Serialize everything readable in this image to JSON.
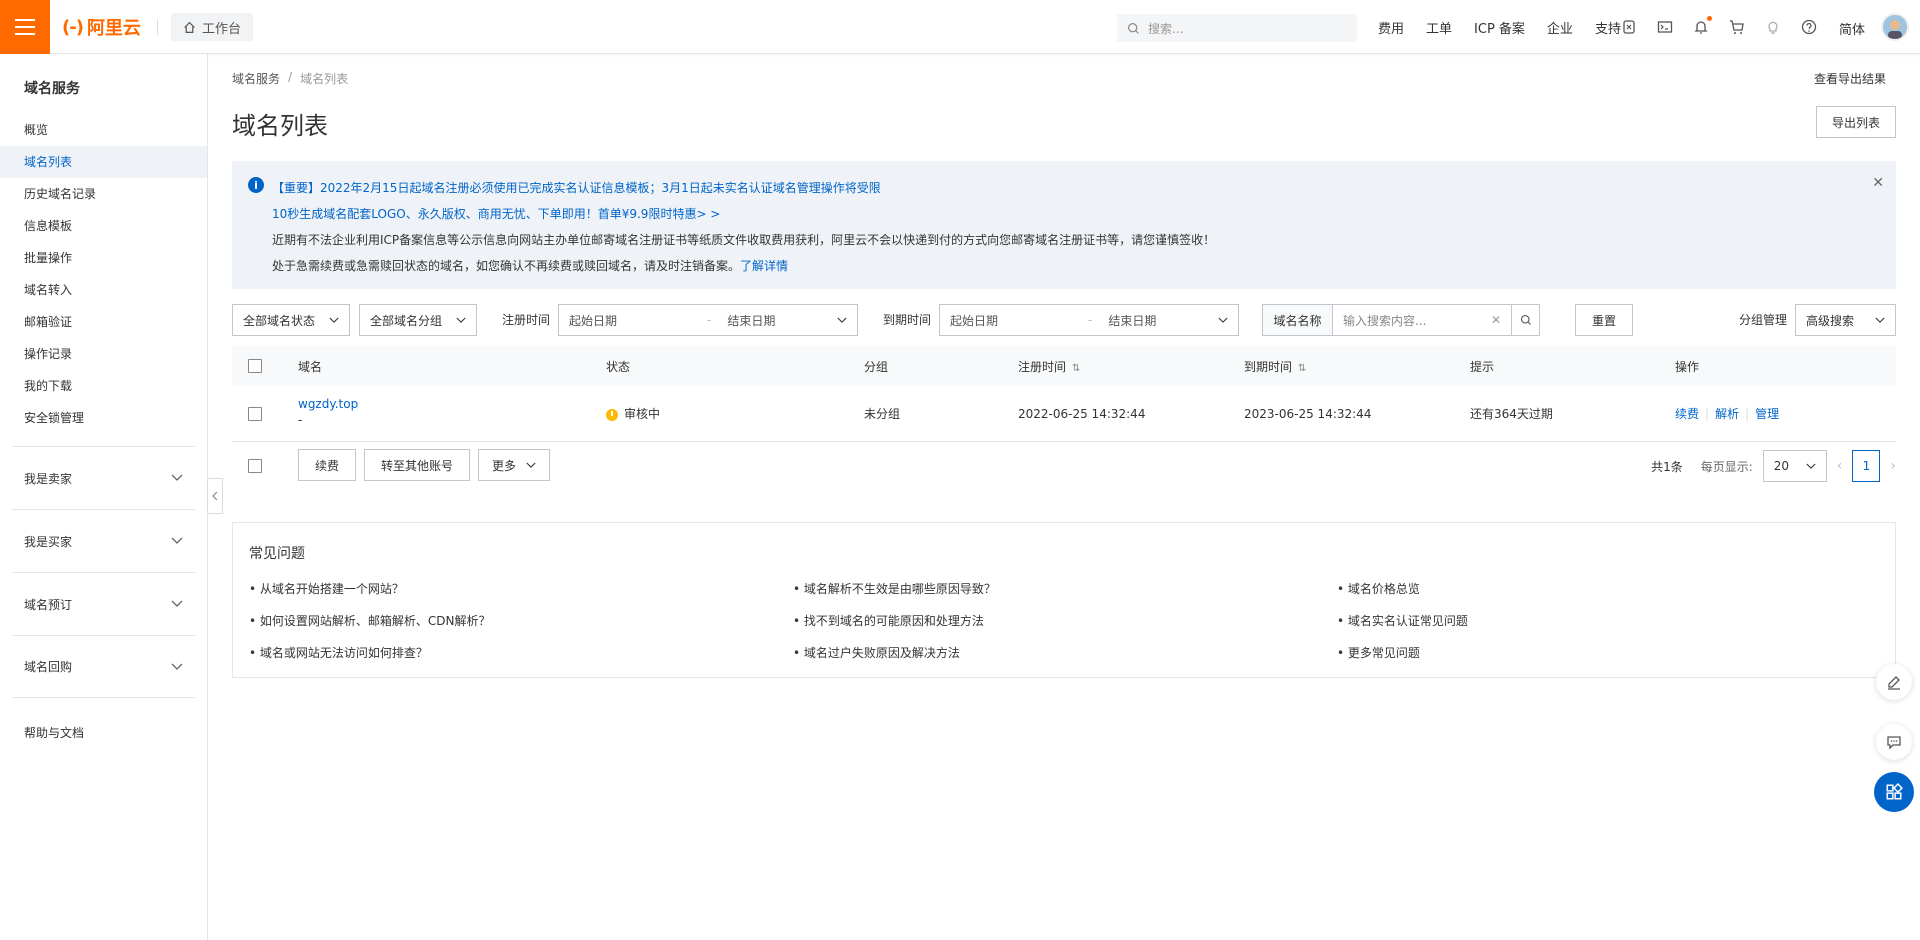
{
  "topbar": {
    "logo_text": "阿里云",
    "workbench": "工作台",
    "search_placeholder": "搜索...",
    "links": [
      "费用",
      "工单",
      "ICP 备案",
      "企业",
      "支持"
    ],
    "lang": "简体",
    "accent": "#ff6a00"
  },
  "sidebar": {
    "title": "域名服务",
    "items": [
      "概览",
      "域名列表",
      "历史域名记录",
      "信息模板",
      "批量操作",
      "域名转入",
      "邮箱验证",
      "操作记录",
      "我的下载",
      "安全锁管理"
    ],
    "active_index": 1,
    "groups": [
      "我是卖家",
      "我是买家",
      "域名预订",
      "域名回购"
    ],
    "help": "帮助与文档"
  },
  "breadcrumb": {
    "root": "域名服务",
    "sep": "/",
    "current": "域名列表"
  },
  "export_result": "查看导出结果",
  "page_title": "域名列表",
  "export_button": "导出列表",
  "notice": {
    "line1": "【重要】2022年2月15日起域名注册必须使用已完成实名认证信息模板；3月1日起未实名认证域名管理操作将受限",
    "line2": "10秒生成域名配套LOGO、永久版权、商用无忧、下单即用！首单¥9.9限时特惠> >",
    "line3": "近期有不法企业利用ICP备案信息等公示信息向网站主办单位邮寄域名注册证书等纸质文件收取费用获利，阿里云不会以快递到付的方式向您邮寄域名注册证书等，请您谨慎签收！",
    "line4": "处于急需续费或急需赎回状态的域名，如您确认不再续费或赎回域名，请及时注销备案。",
    "line4_link": "了解详情"
  },
  "filters": {
    "status": "全部域名状态",
    "group": "全部域名分组",
    "reg_label": "注册时间",
    "reg_start": "起始日期",
    "reg_end": "结束日期",
    "exp_label": "到期时间",
    "exp_start": "起始日期",
    "exp_end": "结束日期",
    "search_label": "域名名称",
    "search_placeholder": "输入搜索内容...",
    "reset": "重置",
    "group_manage": "分组管理",
    "advanced": "高级搜索"
  },
  "table": {
    "columns": [
      "域名",
      "状态",
      "分组",
      "注册时间",
      "到期时间",
      "提示",
      "操作"
    ],
    "rows": [
      {
        "domain": "wgzdy.top",
        "sub": "-",
        "status": "审核中",
        "group": "未分组",
        "reg_time": "2022-06-25 14:32:44",
        "exp_time": "2023-06-25 14:32:44",
        "hint": "还有364天过期",
        "ops": [
          "续费",
          "解析",
          "管理"
        ]
      }
    ]
  },
  "bulk": {
    "renew": "续费",
    "transfer": "转至其他账号",
    "more": "更多"
  },
  "pager": {
    "total": "共1条",
    "per_page_label": "每页显示:",
    "per_page": "20",
    "current_page": "1"
  },
  "faq": {
    "title": "常见问题",
    "col1": [
      "• 从域名开始搭建一个网站？",
      "• 如何设置网站解析、邮箱解析、CDN解析？",
      "• 域名或网站无法访问如何排查？"
    ],
    "col2": [
      "• 域名解析不生效是由哪些原因导致？",
      "• 找不到域名的可能原因和处理方法",
      "• 域名过户失败原因及解决方法"
    ],
    "col3": [
      "• 域名价格总览",
      "• 域名实名认证常见问题",
      "• 更多常见问题"
    ]
  }
}
